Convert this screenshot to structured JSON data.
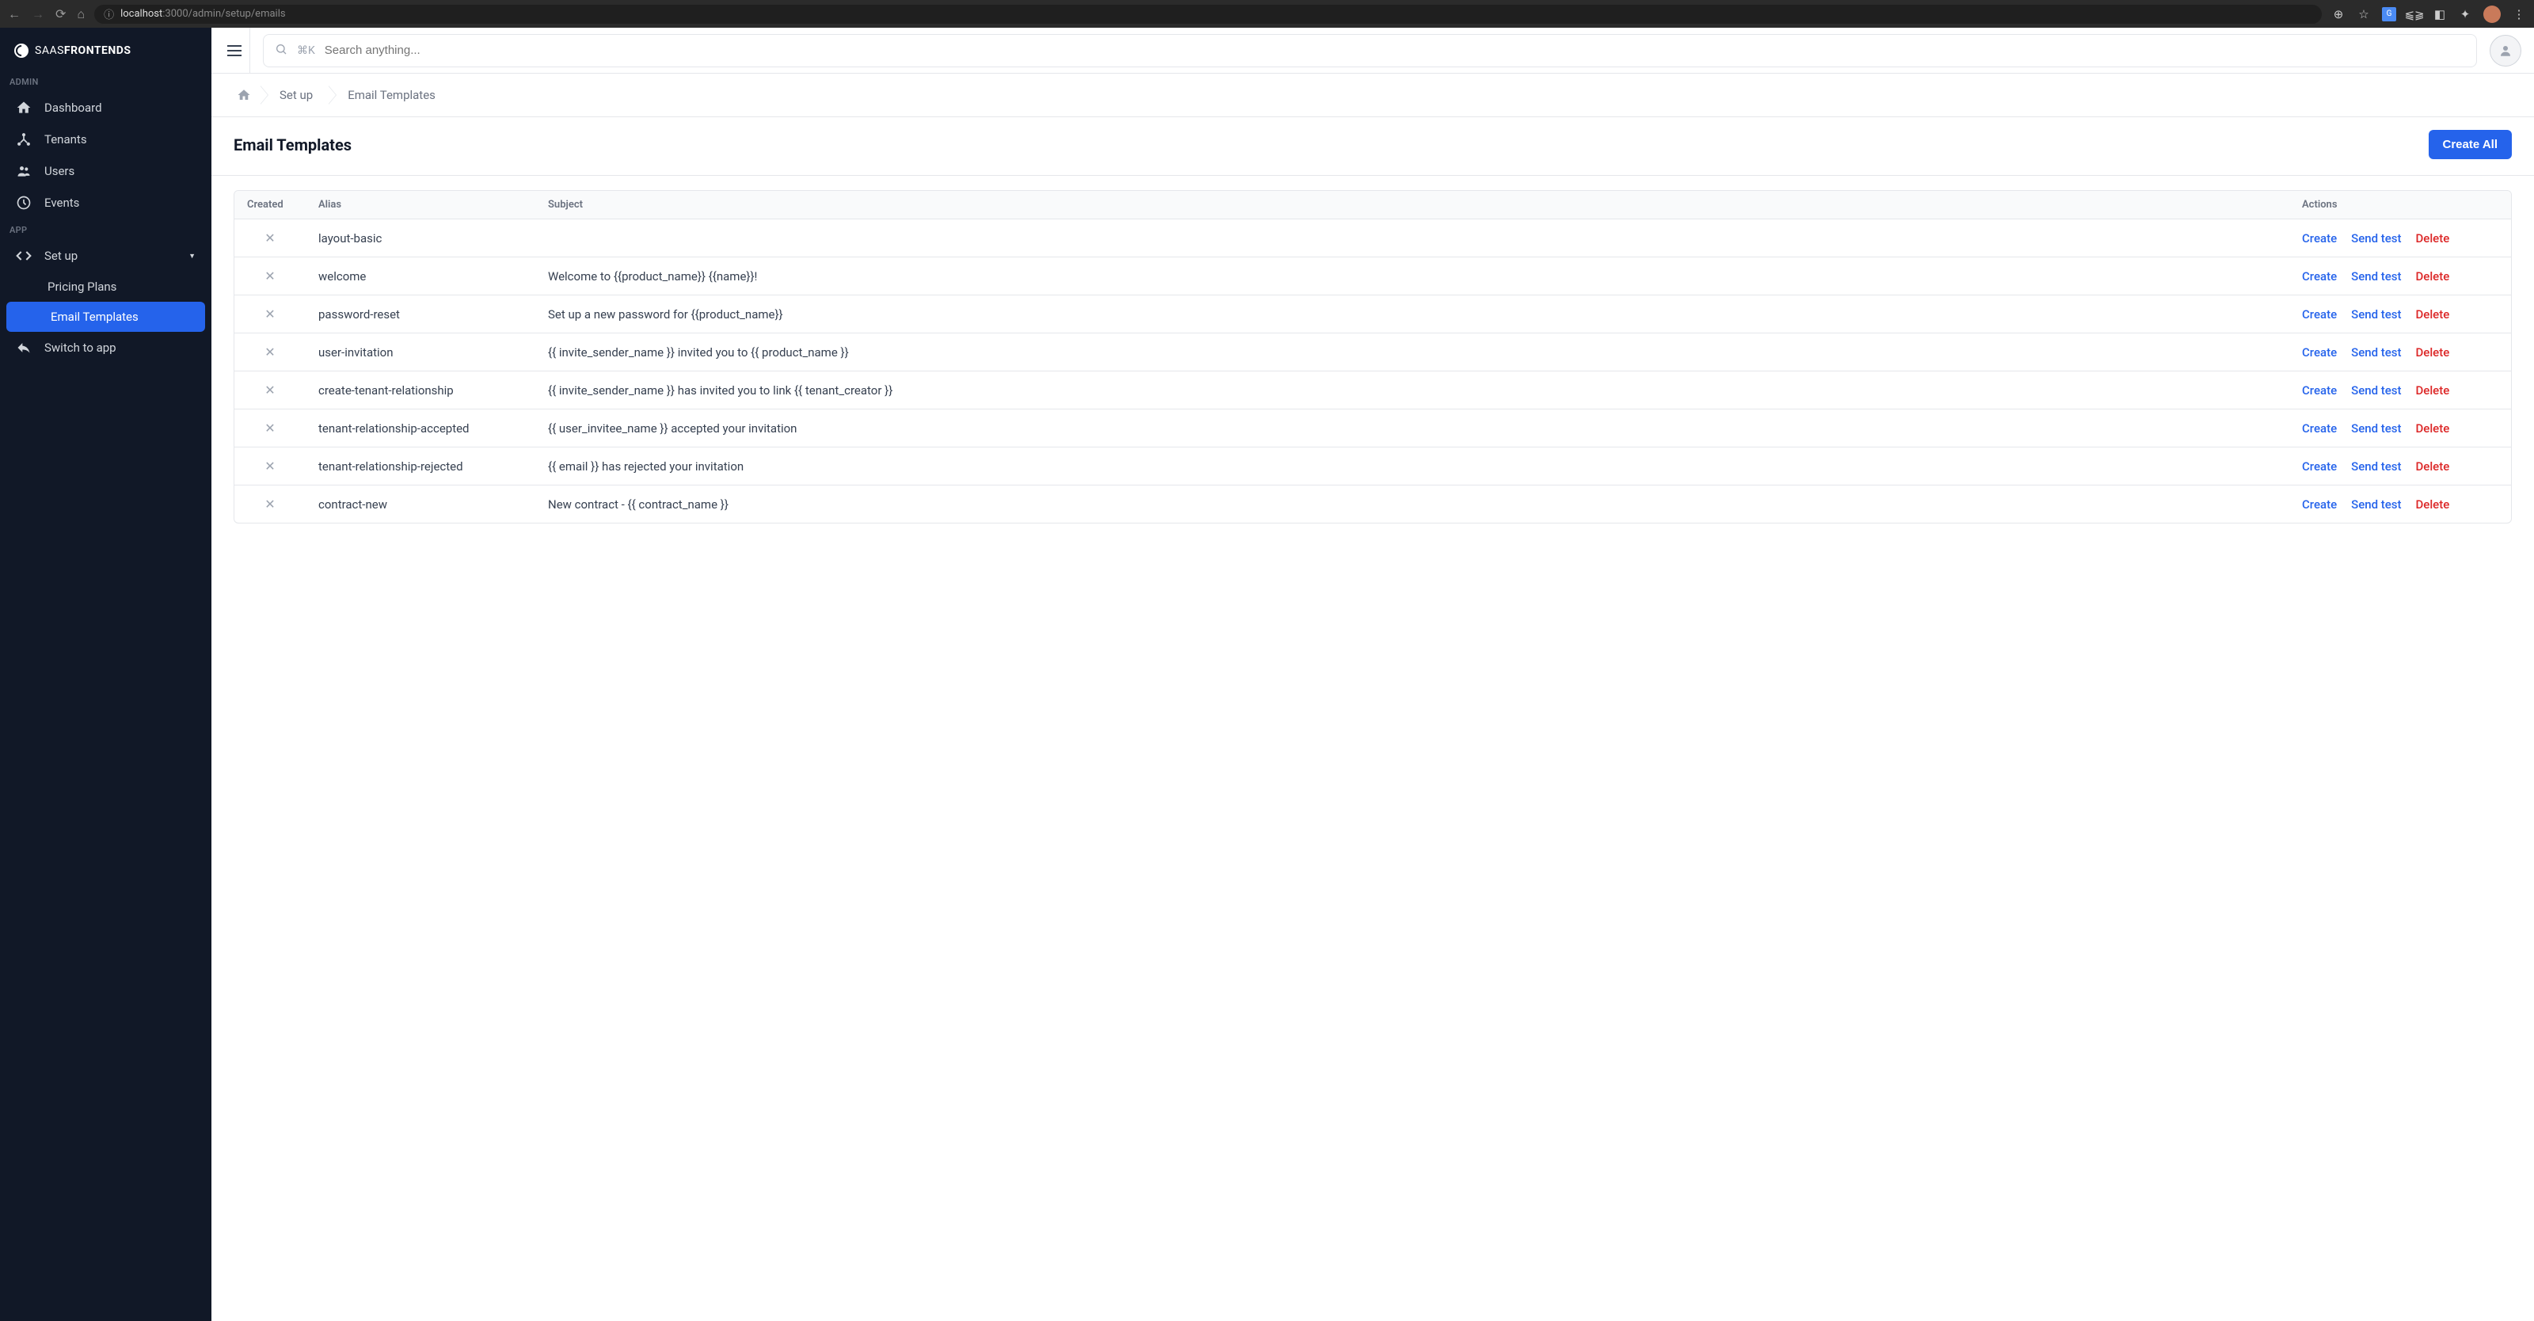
{
  "browser": {
    "url_prefix": "localhost",
    "url_path": ":3000/admin/setup/emails"
  },
  "logo": {
    "brand_light": "SAAS",
    "brand_bold": "FRONTENDS"
  },
  "sidebar": {
    "section_admin": "ADMIN",
    "section_app": "APP",
    "items": [
      {
        "label": "Dashboard"
      },
      {
        "label": "Tenants"
      },
      {
        "label": "Users"
      },
      {
        "label": "Events"
      }
    ],
    "setup": {
      "label": "Set up"
    },
    "setup_sub": [
      {
        "label": "Pricing Plans"
      },
      {
        "label": "Email Templates"
      }
    ],
    "switch": {
      "label": "Switch to app"
    }
  },
  "topbar": {
    "search_kbd": "⌘K",
    "search_placeholder": "Search anything..."
  },
  "breadcrumb": {
    "setup": "Set up",
    "current": "Email Templates"
  },
  "page": {
    "title": "Email Templates",
    "create_all": "Create All"
  },
  "table": {
    "headers": {
      "created": "Created",
      "alias": "Alias",
      "subject": "Subject",
      "actions": "Actions"
    },
    "actions": {
      "create": "Create",
      "send_test": "Send test",
      "delete": "Delete"
    },
    "rows": [
      {
        "alias": "layout-basic",
        "subject": ""
      },
      {
        "alias": "welcome",
        "subject": "Welcome to {{product_name}} {{name}}!"
      },
      {
        "alias": "password-reset",
        "subject": "Set up a new password for {{product_name}}"
      },
      {
        "alias": "user-invitation",
        "subject": "{{ invite_sender_name }} invited you to {{ product_name }}"
      },
      {
        "alias": "create-tenant-relationship",
        "subject": "{{ invite_sender_name }} has invited you to link {{ tenant_creator }}"
      },
      {
        "alias": "tenant-relationship-accepted",
        "subject": "{{ user_invitee_name }} accepted your invitation"
      },
      {
        "alias": "tenant-relationship-rejected",
        "subject": "{{ email }} has rejected your invitation"
      },
      {
        "alias": "contract-new",
        "subject": "New contract - {{ contract_name }}"
      }
    ]
  }
}
